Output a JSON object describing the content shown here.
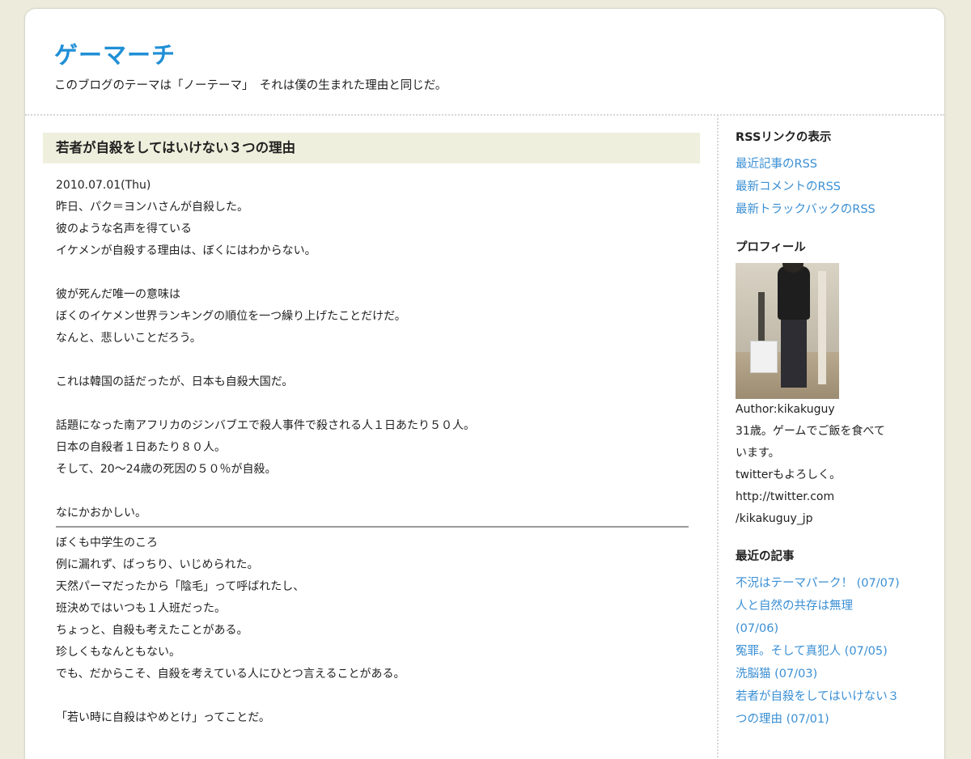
{
  "site": {
    "title": "ゲーマーチ",
    "description": "このブログのテーマは「ノーテーマ」　それは僕の生まれた理由と同じだ。"
  },
  "post": {
    "title": "若者が自殺をしてはいけない３つの理由",
    "date": "2010.07.01(Thu)",
    "paragraphs_before": [
      [
        "昨日、パク＝ヨンハさんが自殺した。",
        "彼のような名声を得ている",
        "イケメンが自殺する理由は、ぼくにはわからない。"
      ],
      [
        "彼が死んだ唯一の意味は",
        "ぼくのイケメン世界ランキングの順位を一つ繰り上げたことだけだ。",
        "なんと、悲しいことだろう。"
      ],
      [
        "これは韓国の話だったが、日本も自殺大国だ。"
      ],
      [
        "話題になった南アフリカのジンバブエで殺人事件で殺される人１日あたり５０人。",
        "日本の自殺者１日あたり８０人。",
        "そして、20～24歳の死因の５０％が自殺。"
      ],
      [
        "なにかおかしい。"
      ]
    ],
    "paragraphs_after": [
      [
        "ぼくも中学生のころ",
        "例に漏れず、ばっちり、いじめられた。",
        "天然パーマだったから「陰毛」って呼ばれたし、",
        "班決めではいつも１人班だった。",
        "ちょっと、自殺も考えたことがある。",
        "珍しくもなんともない。",
        "でも、だからこそ、自殺を考えている人にひとつ言えることがある。"
      ],
      [
        "「若い時に自殺はやめとけ」ってことだ。"
      ]
    ]
  },
  "sidebar": {
    "rss": {
      "heading": "RSSリンクの表示",
      "links": [
        "最近記事のRSS",
        "最新コメントのRSS",
        "最新トラックバックのRSS"
      ]
    },
    "profile": {
      "heading": "プロフィール",
      "lines": [
        "Author:kikakuguy",
        "31歳。ゲームでご飯を食べて",
        "います。",
        "twitterもよろしく。",
        "http://twitter.com",
        "/kikakuguy_jp"
      ]
    },
    "recent": {
      "heading": "最近の記事",
      "lines": [
        "不況はテーマパーク！ (07/07)",
        "人と自然の共存は無理",
        "(07/06)",
        "冤罪。そして真犯人 (07/05)",
        "洗脳猫 (07/03)",
        "若者が自殺をしてはいけない３",
        "つの理由 (07/01)"
      ]
    }
  },
  "colors": {
    "background": "#ecebdc",
    "title_blue": "#1f8fd6",
    "link_blue": "#3a8fd4",
    "post_title_bg": "#efefdd"
  }
}
